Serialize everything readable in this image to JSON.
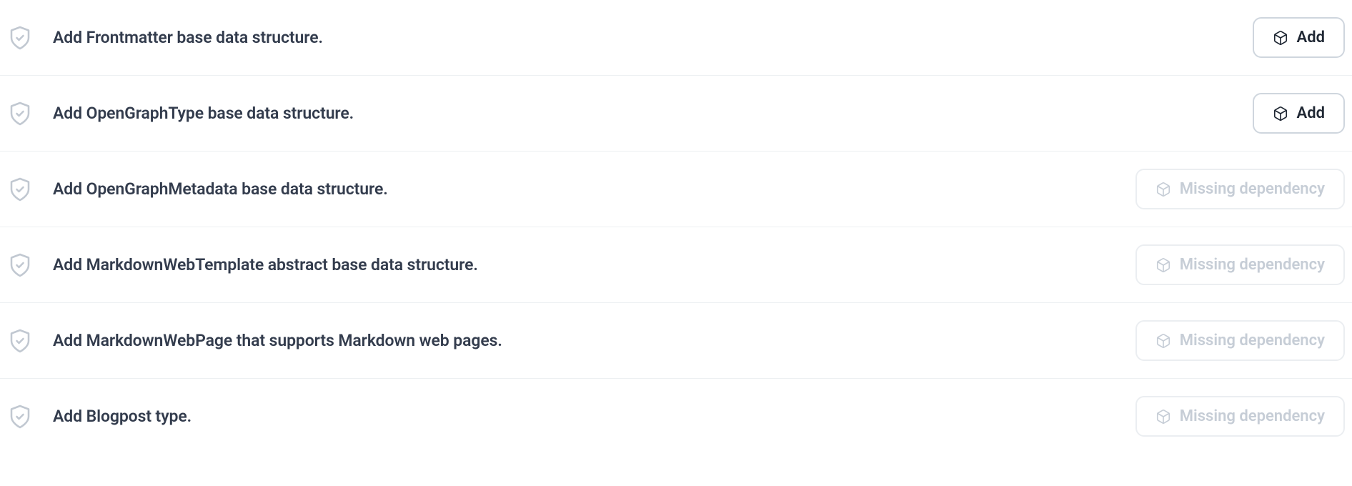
{
  "buttons": {
    "add_label": "Add",
    "missing_label": "Missing dependency"
  },
  "rows": [
    {
      "title": "Add Frontmatter base data structure.",
      "enabled": true
    },
    {
      "title": "Add OpenGraphType base data structure.",
      "enabled": true
    },
    {
      "title": "Add OpenGraphMetadata base data structure.",
      "enabled": false
    },
    {
      "title": "Add MarkdownWebTemplate abstract base data structure.",
      "enabled": false
    },
    {
      "title": "Add MarkdownWebPage that supports Markdown web pages.",
      "enabled": false
    },
    {
      "title": "Add Blogpost type.",
      "enabled": false
    }
  ]
}
